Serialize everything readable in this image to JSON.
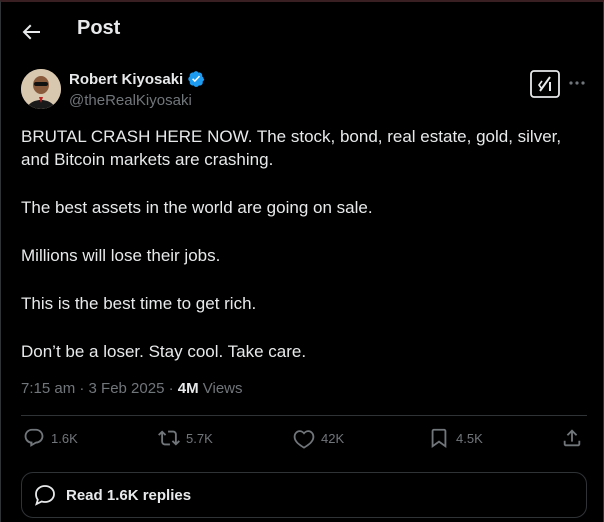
{
  "header": {
    "title": "Post"
  },
  "author": {
    "name": "Robert Kiyosaki",
    "handle": "@theRealKiyosaki",
    "verified_color": "#1d9bf0"
  },
  "post": {
    "paragraphs": [
      "BRUTAL CRASH HERE NOW.  The stock, bond, real estate, gold, silver, and Bitcoin markets are crashing.",
      "The best assets in the world are going on sale.",
      "Millions will lose their jobs.",
      "This is the best time to get rich.",
      "Don’t be a loser.  Stay cool.  Take care."
    ],
    "timestamp": "7:15 am · 3 Feb 2025 · ",
    "views_count": "4M",
    "views_label": " Views"
  },
  "actions": {
    "replies": "1.6K",
    "reposts": "5.7K",
    "likes": "42K",
    "bookmarks": "4.5K"
  },
  "replies_button": {
    "label": "Read 1.6K replies"
  },
  "icons": {
    "back": "arrow-left-icon",
    "verified": "verified-badge-icon",
    "grok": "grok-icon",
    "more": "more-dots-icon",
    "reply": "reply-icon",
    "repost": "repost-icon",
    "like": "heart-icon",
    "bookmark": "bookmark-icon",
    "share": "share-icon",
    "replies_bubble": "speech-bubble-icon"
  },
  "colors": {
    "background": "#000000",
    "text": "#e7e9ea",
    "secondary": "#71767b",
    "border": "#2f3336",
    "accent": "#1d9bf0"
  }
}
